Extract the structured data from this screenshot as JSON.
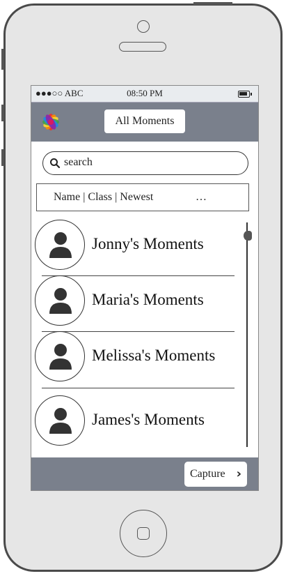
{
  "status_bar": {
    "carrier": "●●●○○ ABC",
    "time": "08:50 PM"
  },
  "nav": {
    "logo_icon": "flower-logo-icon",
    "title": "All Moments"
  },
  "search": {
    "icon": "search-icon",
    "text": "search"
  },
  "filter": {
    "options": "Name | Class | Newest",
    "more": "…"
  },
  "moments": [
    {
      "label": "Jonny's Moments"
    },
    {
      "label": "Maria's Moments"
    },
    {
      "label": "Melissa's Moments"
    },
    {
      "label": "James's Moments"
    }
  ],
  "toolbar": {
    "capture_label": "Capture",
    "capture_icon": "chevron-right-icon"
  },
  "colors": {
    "bar": "#7a808c",
    "status": "#e9ecef",
    "phone": "#e6e6e6"
  }
}
